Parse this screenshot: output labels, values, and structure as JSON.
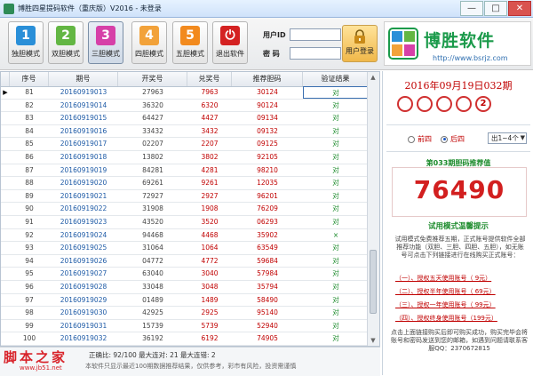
{
  "window": {
    "title": "博胜四星提码软件（重庆版）V2016 - 未登录",
    "buttons": [
      "—",
      "□",
      "✕"
    ]
  },
  "toolbar": {
    "buttons": [
      {
        "num": "1",
        "label": "独胆模式",
        "color": "#2a8fd8"
      },
      {
        "num": "2",
        "label": "双胆模式",
        "color": "#63b643"
      },
      {
        "num": "3",
        "label": "三胆模式",
        "color": "#d640a8"
      },
      {
        "num": "4",
        "label": "四胆模式",
        "color": "#f2a23a"
      },
      {
        "num": "5",
        "label": "五胆模式",
        "color": "#f28a1e"
      },
      {
        "num": "⏻",
        "label": "退出软件",
        "color": "#d42222"
      }
    ],
    "user_label": "用户ID",
    "pass_label": "密 码",
    "login_label": "用户登录"
  },
  "logo": {
    "mark": "BS",
    "name": "博胜软件",
    "url": "http://www.bsrjz.com"
  },
  "table": {
    "columns": [
      "序号",
      "期号",
      "开奖号",
      "兑奖号",
      "推荐胆码",
      "验证结果"
    ],
    "rows": [
      {
        "seq": "81",
        "issue": "20160919013",
        "win": "27963",
        "dui": "7963",
        "rec": "30124",
        "res": "对"
      },
      {
        "seq": "82",
        "issue": "20160919014",
        "win": "36320",
        "dui": "6320",
        "rec": "90124",
        "res": "对"
      },
      {
        "seq": "83",
        "issue": "20160919015",
        "win": "64427",
        "dui": "4427",
        "rec": "09134",
        "res": "对"
      },
      {
        "seq": "84",
        "issue": "20160919016",
        "win": "33432",
        "dui": "3432",
        "rec": "09132",
        "res": "对"
      },
      {
        "seq": "85",
        "issue": "20160919017",
        "win": "02207",
        "dui": "2207",
        "rec": "09125",
        "res": "对"
      },
      {
        "seq": "86",
        "issue": "20160919018",
        "win": "13802",
        "dui": "3802",
        "rec": "92105",
        "res": "对"
      },
      {
        "seq": "87",
        "issue": "20160919019",
        "win": "84281",
        "dui": "4281",
        "rec": "98210",
        "res": "对"
      },
      {
        "seq": "88",
        "issue": "20160919020",
        "win": "69261",
        "dui": "9261",
        "rec": "12035",
        "res": "对"
      },
      {
        "seq": "89",
        "issue": "20160919021",
        "win": "72927",
        "dui": "2927",
        "rec": "96201",
        "res": "对"
      },
      {
        "seq": "90",
        "issue": "20160919022",
        "win": "31908",
        "dui": "1908",
        "rec": "76209",
        "res": "对"
      },
      {
        "seq": "91",
        "issue": "20160919023",
        "win": "43520",
        "dui": "3520",
        "rec": "06293",
        "res": "对"
      },
      {
        "seq": "92",
        "issue": "20160919024",
        "win": "94468",
        "dui": "4468",
        "rec": "35902",
        "res": "×"
      },
      {
        "seq": "93",
        "issue": "20160919025",
        "win": "31064",
        "dui": "1064",
        "rec": "63549",
        "res": "对"
      },
      {
        "seq": "94",
        "issue": "20160919026",
        "win": "04772",
        "dui": "4772",
        "rec": "59684",
        "res": "对"
      },
      {
        "seq": "95",
        "issue": "20160919027",
        "win": "63040",
        "dui": "3040",
        "rec": "57984",
        "res": "对"
      },
      {
        "seq": "96",
        "issue": "20160919028",
        "win": "33048",
        "dui": "3048",
        "rec": "35794",
        "res": "对"
      },
      {
        "seq": "97",
        "issue": "20160919029",
        "win": "01489",
        "dui": "1489",
        "rec": "58490",
        "res": "对"
      },
      {
        "seq": "98",
        "issue": "20160919030",
        "win": "42925",
        "dui": "2925",
        "rec": "95140",
        "res": "对"
      },
      {
        "seq": "99",
        "issue": "20160919031",
        "win": "15739",
        "dui": "5739",
        "rec": "52940",
        "res": "对"
      },
      {
        "seq": "100",
        "issue": "20160919032",
        "win": "36192",
        "dui": "6192",
        "rec": "74905",
        "res": "对"
      }
    ]
  },
  "status": {
    "line1": "正确比: 92/100 最大连对: 21 最大连错: 2",
    "line2": "本软件只显示最近100期数据推荐结果，仅供参考，彩市有风险，投资需谨慎"
  },
  "watermark": {
    "text": "脚本之家",
    "url": "www.jb51.net"
  },
  "right": {
    "issue_title": "2016年09月19日032期",
    "balls": [
      "",
      "",
      "",
      "",
      "2"
    ],
    "radio_front": "前四",
    "radio_back": "后四",
    "select_value": "出1~4个",
    "rec_caption": "第033期胆码推荐值",
    "rec_value": "76490",
    "tip_title": "试用模式温馨提示",
    "tip_text": "试用模式免费推荐五期，正式账号提供软件全部推荐功能（双胆、三胆、四胆、五胆），如无账号可点击下列链接进行在线购买正式账号：",
    "plans": [
      "（一）、授权五天使用账号（ 9元）",
      "（二）、授权半年使用账号（ 69元）",
      "（三）、授权一年使用账号（ 99元）",
      "（四）、授权终身使用账号（199元）"
    ],
    "foot_text": "点击上面链接购买后即可购买成功，购买完毕会将账号和密码发送到您的邮箱，如遇到问题请联系客服QQ：2370672815"
  }
}
